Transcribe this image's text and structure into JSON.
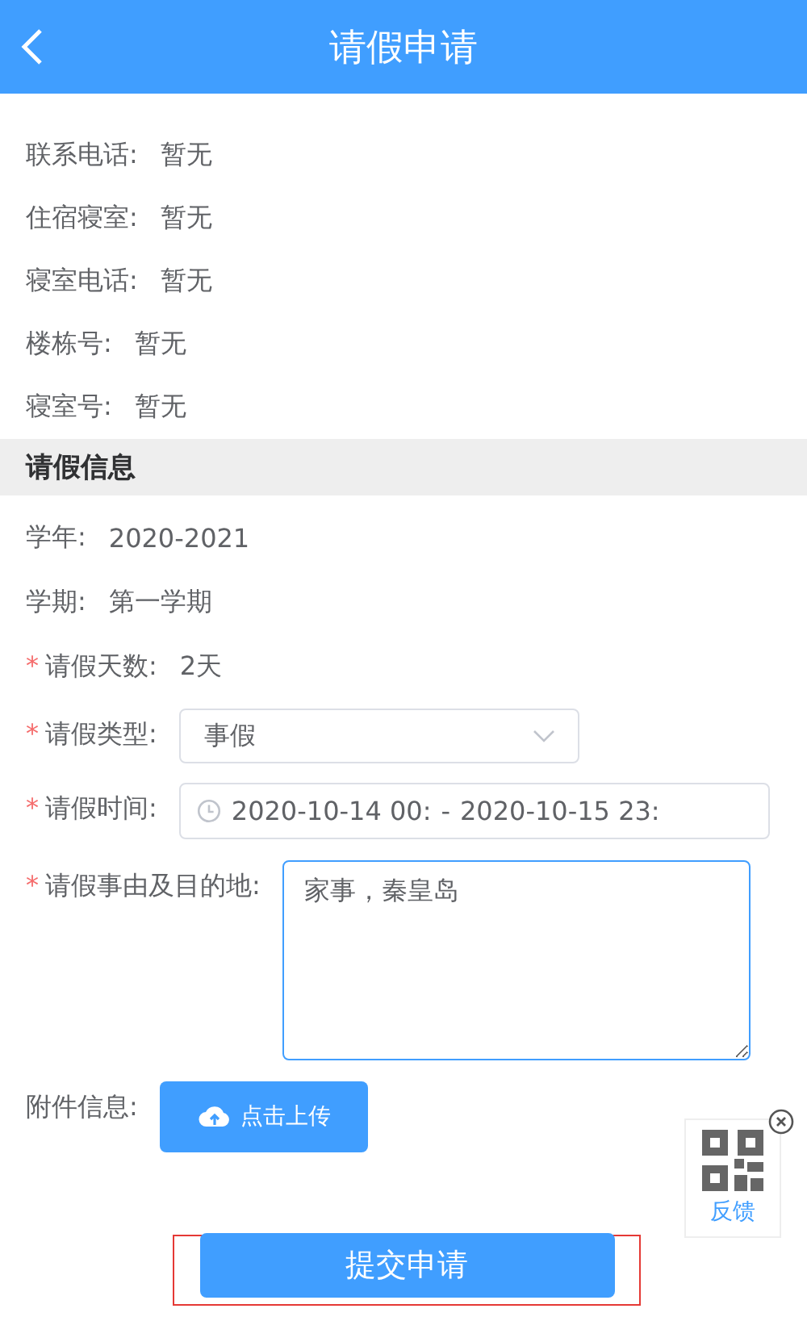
{
  "header": {
    "title": "请假申请"
  },
  "info_rows": [
    {
      "label": "联系电话:",
      "value": "暂无"
    },
    {
      "label": "住宿寝室:",
      "value": "暂无"
    },
    {
      "label": "寝室电话:",
      "value": "暂无"
    },
    {
      "label": "楼栋号:",
      "value": "暂无"
    },
    {
      "label": "寝室号:",
      "value": "暂无"
    }
  ],
  "section": {
    "title": "请假信息"
  },
  "fields": [
    {
      "kind": "text",
      "label": "学年:",
      "value": "2020-2021"
    },
    {
      "kind": "text",
      "label": "学期:",
      "value": "第一学期"
    },
    {
      "kind": "text",
      "required_mark": "*",
      "label": "请假天数:",
      "value": "2天"
    },
    {
      "kind": "select",
      "required_mark": "*",
      "label": "请假类型:",
      "value": "事假"
    },
    {
      "kind": "daterange",
      "required_mark": "*",
      "label": "请假时间:",
      "start": "2020-10-14 00:",
      "separator": "-",
      "end": "2020-10-15 23:"
    },
    {
      "kind": "textarea",
      "required_mark": "*",
      "label": "请假事由及目的地:",
      "value": "家事，秦皇岛"
    },
    {
      "kind": "upload",
      "label": "附件信息:",
      "button": "点击上传"
    }
  ],
  "submit": "提交申请",
  "feedback": {
    "label": "反馈"
  }
}
